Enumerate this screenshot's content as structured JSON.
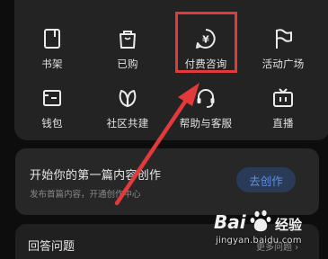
{
  "menu": {
    "row1": [
      {
        "label": "书架",
        "icon": "bookshelf-icon"
      },
      {
        "label": "已购",
        "icon": "shopping-bag-icon"
      },
      {
        "label": "付费咨询",
        "icon": "paid-consult-icon"
      },
      {
        "label": "活动广场",
        "icon": "flag-icon"
      }
    ],
    "row2": [
      {
        "label": "钱包",
        "icon": "wallet-icon"
      },
      {
        "label": "社区共建",
        "icon": "leaf-icon"
      },
      {
        "label": "帮助与客服",
        "icon": "headset-icon"
      },
      {
        "label": "直播",
        "icon": "tv-icon"
      }
    ]
  },
  "create_card": {
    "title": "开始你的第一篇内容创作",
    "subtitle": "发布首篇内容，开通创作中心",
    "button": "去创作"
  },
  "qa_card": {
    "title": "回答问题",
    "more": "更多问题 ›"
  },
  "watermark": {
    "logo_text": "Bai 经验",
    "url": "jingyan.baidu.com"
  },
  "colors": {
    "highlight": "#e23a3a",
    "accent": "#5e8fe0"
  }
}
